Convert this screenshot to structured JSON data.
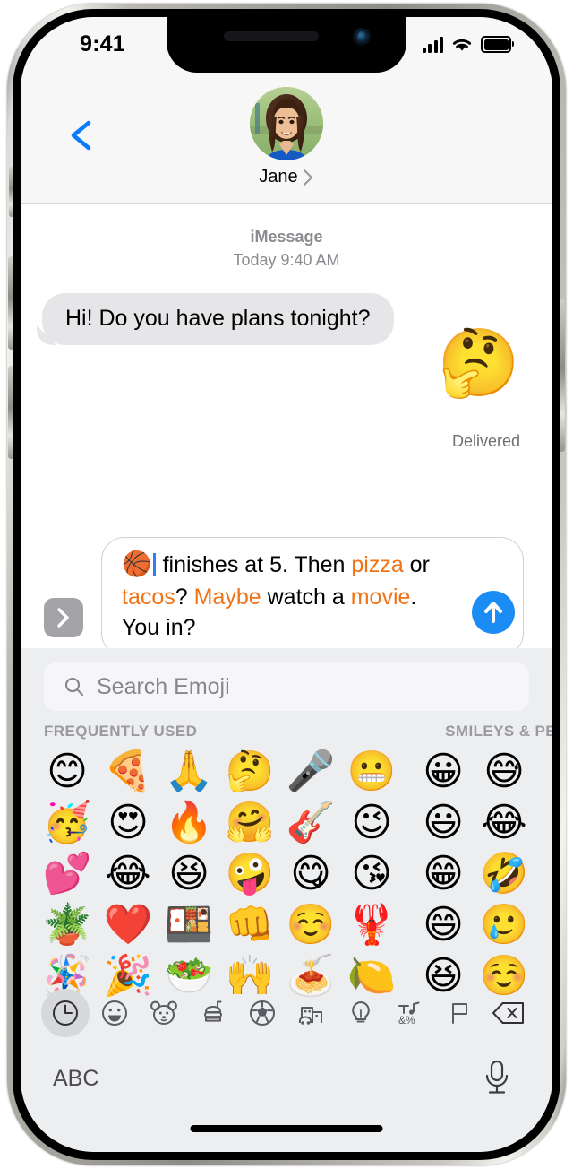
{
  "status_bar": {
    "time": "9:41",
    "signal_icon": "cellular-signal-icon",
    "wifi_icon": "wifi-icon",
    "battery_icon": "battery-full-icon"
  },
  "nav_header": {
    "back_icon": "chevron-left-icon",
    "contact_name": "Jane",
    "contact_chevron_icon": "chevron-right-icon",
    "avatar_alt": "Jane"
  },
  "conversation": {
    "service_label": "iMessage",
    "timestamp": "Today 9:40 AM",
    "messages": [
      {
        "direction": "incoming",
        "type": "text",
        "text": "Hi! Do you have plans tonight?"
      },
      {
        "direction": "outgoing",
        "type": "emoji",
        "text": "🤔",
        "status": "Delivered"
      }
    ],
    "delivered_label": "Delivered"
  },
  "compose": {
    "expand_icon": "chevron-right-icon",
    "send_icon": "arrow-up-icon",
    "emoji_prefix": "🏀",
    "segments": [
      {
        "text": " finishes at 5. Then ",
        "highlight": false
      },
      {
        "text": "pizza",
        "highlight": true
      },
      {
        "text": " or ",
        "highlight": false
      },
      {
        "text": "tacos",
        "highlight": true
      },
      {
        "text": "? ",
        "highlight": false
      },
      {
        "text": "Maybe",
        "highlight": true
      },
      {
        "text": " watch a ",
        "highlight": false
      },
      {
        "text": "movie",
        "highlight": true
      },
      {
        "text": ". You in?",
        "highlight": false
      }
    ],
    "full_text": "🏀 finishes at 5. Then pizza or tacos? Maybe watch a movie. You in?",
    "highlight_color": "#f07317",
    "send_color": "#1c8cf5"
  },
  "emoji_keyboard": {
    "search": {
      "placeholder": "Search Emoji",
      "value": "",
      "icon": "search-icon"
    },
    "sections": [
      {
        "title": "FREQUENTLY USED"
      },
      {
        "title": "SMILEYS & PE"
      }
    ],
    "frequently_used": [
      "😊",
      "🍕",
      "🙏",
      "🤔",
      "🎤",
      "😬",
      "🥳",
      "😍",
      "🔥",
      "🤗",
      "🎸",
      "😉",
      "💕",
      "😂",
      "😆",
      "🤪",
      "😋",
      "😘",
      "🪴",
      "❤️",
      "🍱",
      "👊",
      "☺️",
      "🦞",
      "🪅",
      "🎉",
      "🥗",
      "🙌",
      "🍝",
      "🍋"
    ],
    "smileys_people": [
      "😀",
      "😅",
      "😃",
      "😂",
      "😁",
      "🤣",
      "😄",
      "🥲",
      "😆",
      "☺️"
    ],
    "category_tabs": [
      {
        "name": "recents",
        "icon": "clock-icon",
        "selected": true
      },
      {
        "name": "smileys-people",
        "icon": "smiley-icon",
        "selected": false
      },
      {
        "name": "animals-nature",
        "icon": "bear-icon",
        "selected": false
      },
      {
        "name": "food-drink",
        "icon": "food-icon",
        "selected": false
      },
      {
        "name": "activity",
        "icon": "soccer-ball-icon",
        "selected": false
      },
      {
        "name": "travel-places",
        "icon": "car-building-icon",
        "selected": false
      },
      {
        "name": "objects",
        "icon": "lightbulb-icon",
        "selected": false
      },
      {
        "name": "symbols",
        "icon": "symbols-icon",
        "selected": false
      },
      {
        "name": "flags",
        "icon": "flag-icon",
        "selected": false
      },
      {
        "name": "delete",
        "icon": "backspace-icon",
        "selected": false
      }
    ],
    "bottom_bar": {
      "abc_label": "ABC",
      "mic_icon": "microphone-icon"
    }
  }
}
